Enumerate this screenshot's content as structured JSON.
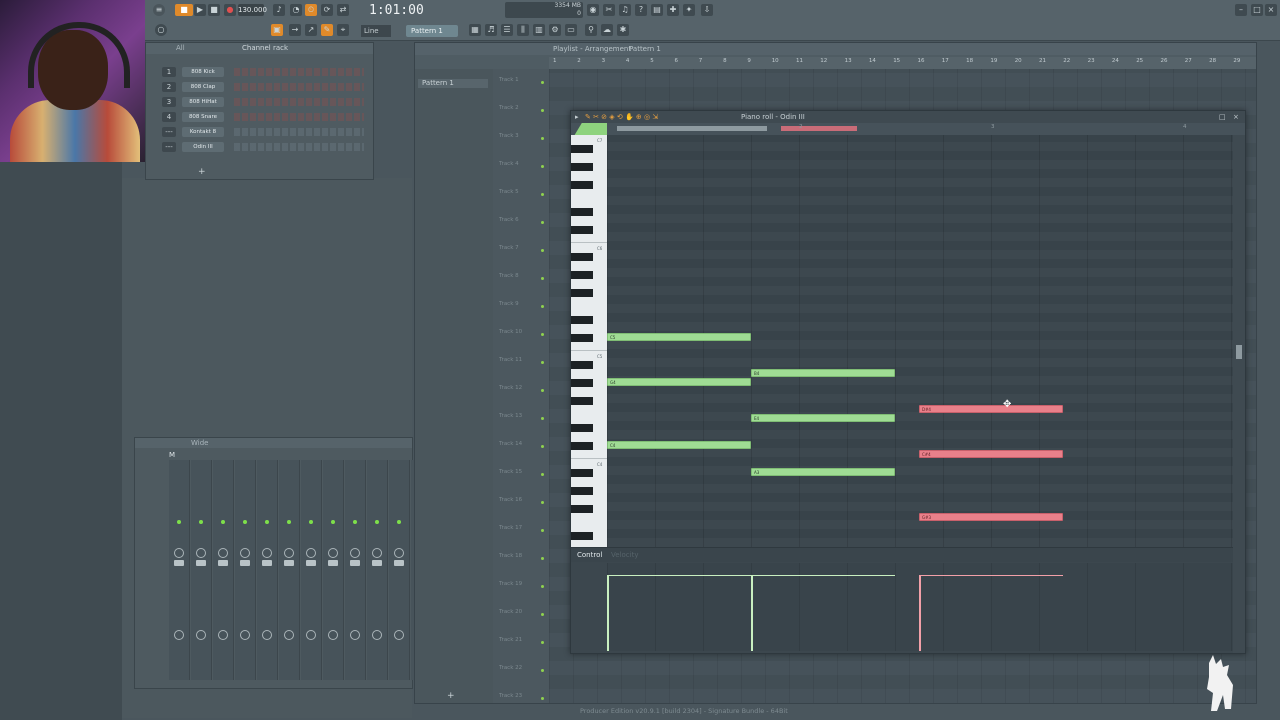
{
  "toolbar": {
    "tempo": "130.000",
    "clock": "1:01:00",
    "cpu": "3354 MB",
    "cpu2": "0",
    "pattern": "Pattern 1",
    "snap": "Line"
  },
  "channel_rack": {
    "title": "Channel rack",
    "filter": "All",
    "channels": [
      {
        "num": "1",
        "name": "808 Kick"
      },
      {
        "num": "2",
        "name": "808 Clap"
      },
      {
        "num": "3",
        "name": "808 HiHat"
      },
      {
        "num": "4",
        "name": "808 Snare"
      },
      {
        "num": "---",
        "name": "Kontakt 8"
      },
      {
        "num": "---",
        "name": "Odin III"
      }
    ],
    "add_label": "+"
  },
  "mixer": {
    "title": "Wide",
    "master_label": "M"
  },
  "playlist": {
    "title": "Playlist - Arrangement",
    "pattern_crumb": "Pattern 1",
    "pattern_item": "Pattern 1",
    "tracks": [
      "Track 1",
      "Track 2",
      "Track 3",
      "Track 4",
      "Track 5",
      "Track 6",
      "Track 7",
      "Track 8",
      "Track 9",
      "Track 10",
      "Track 11",
      "Track 12",
      "Track 13",
      "Track 14",
      "Track 15",
      "Track 16",
      "Track 17",
      "Track 18",
      "Track 19",
      "Track 20",
      "Track 21",
      "Track 22",
      "Track 23"
    ],
    "ruler": [
      "1",
      "2",
      "3",
      "4",
      "5",
      "6",
      "7",
      "8",
      "9",
      "10",
      "11",
      "12",
      "13",
      "14",
      "15",
      "16",
      "17",
      "18",
      "19",
      "20",
      "21",
      "22",
      "23",
      "24",
      "25",
      "26",
      "27",
      "28",
      "29"
    ],
    "add_label": "+"
  },
  "piano_roll": {
    "title": "Piano roll - Odin III",
    "ruler": [
      "2",
      "3",
      "4"
    ],
    "key_labels": [
      "C7",
      "C6",
      "C5",
      "C4"
    ],
    "control_label": "Control",
    "control_sub": "Velocity"
  },
  "status": "Producer Edition v20.9.1 [build 2304] - Signature Bundle - 64Bit",
  "colors": {
    "note_green": "#9fdc94",
    "note_red": "#e9808a",
    "led_green": "#7ee04a",
    "accent_orange": "#f0a030"
  },
  "notes": {
    "green": [
      {
        "label": "C5",
        "bar": 0,
        "len": 3,
        "row": 0
      },
      {
        "label": "G4",
        "bar": 0,
        "len": 3,
        "row": 5
      },
      {
        "label": "B4",
        "bar": 3,
        "len": 3,
        "row": 4
      },
      {
        "label": "E4",
        "bar": 3,
        "len": 3,
        "row": 9
      },
      {
        "label": "C4",
        "bar": 0,
        "len": 3,
        "row": 12
      },
      {
        "label": "A3",
        "bar": 3,
        "len": 3,
        "row": 15
      }
    ],
    "red": [
      {
        "label": "D#4",
        "bar": 6.5,
        "len": 3,
        "row": 8
      },
      {
        "label": "C#4",
        "bar": 6.5,
        "len": 3,
        "row": 13
      },
      {
        "label": "G#3",
        "bar": 6.5,
        "len": 3,
        "row": 20
      }
    ]
  }
}
